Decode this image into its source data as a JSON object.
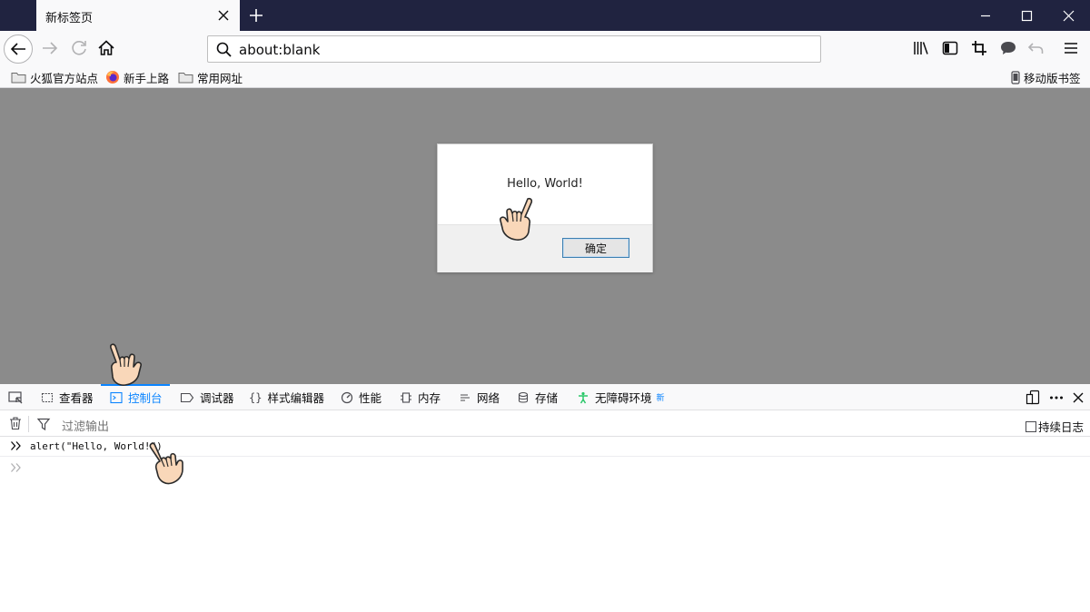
{
  "titlebar": {
    "tab_title": "新标签页",
    "icons": [
      "close-icon",
      "plus-icon",
      "minimize-icon",
      "maximize-icon",
      "close-icon"
    ]
  },
  "navbar": {
    "url": "about:blank"
  },
  "bookmarks": {
    "left": [
      {
        "label": "火狐官方站点",
        "icon": "folder-icon"
      },
      {
        "label": "新手上路",
        "icon": "firefox-icon"
      },
      {
        "label": "常用网址",
        "icon": "folder-icon"
      }
    ],
    "mobile": "移动版书签"
  },
  "dialog": {
    "message": "Hello, World!",
    "ok_label": "确定"
  },
  "devtools": {
    "tabs": [
      {
        "label": "查看器",
        "icon": "inspector-icon"
      },
      {
        "label": "控制台",
        "icon": "console-icon"
      },
      {
        "label": "调试器",
        "icon": "debugger-icon"
      },
      {
        "label": "样式编辑器",
        "icon": "braces-icon"
      },
      {
        "label": "性能",
        "icon": "performance-icon"
      },
      {
        "label": "内存",
        "icon": "memory-icon"
      },
      {
        "label": "网络",
        "icon": "network-icon"
      },
      {
        "label": "存储",
        "icon": "storage-icon"
      },
      {
        "label": "无障碍环境",
        "icon": "accessibility-icon"
      }
    ],
    "new_badge": "新",
    "active_tab": "控制台",
    "filter_placeholder": "过滤输出",
    "persist_logs": "持续日志",
    "console_input": "alert(\"Hello, World!\")"
  },
  "colors": {
    "titlebar": "#202340",
    "accent": "#0a84ff",
    "content_bg": "#8b8b8b",
    "accessibility_green": "#2ac769"
  }
}
